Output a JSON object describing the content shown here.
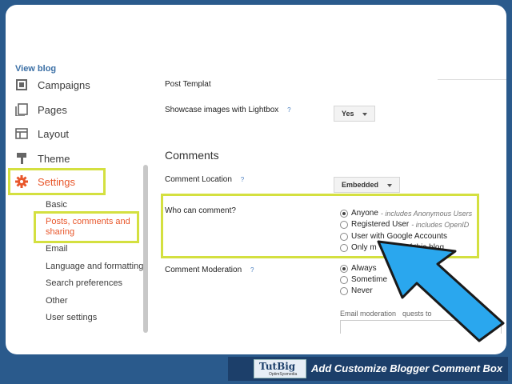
{
  "header": {
    "view_blog": "View blog"
  },
  "sidebar": {
    "items": [
      {
        "label": "Campaigns",
        "icon": "campaigns-icon"
      },
      {
        "label": "Pages",
        "icon": "pages-icon"
      },
      {
        "label": "Layout",
        "icon": "layout-icon"
      },
      {
        "label": "Theme",
        "icon": "theme-icon"
      },
      {
        "label": "Settings",
        "icon": "gear-icon"
      }
    ],
    "sub": [
      "Basic",
      "Posts, comments and sharing",
      "Email",
      "Language and formatting",
      "Search preferences",
      "Other",
      "User settings"
    ]
  },
  "main": {
    "post_template": "Post Templat",
    "showcase_label": "Showcase images with Lightbox",
    "showcase_value": "Yes",
    "section_title": "Comments",
    "comment_location_label": "Comment Location",
    "comment_location_value": "Embedded",
    "who_label": "Who can comment?",
    "who_options": [
      {
        "label": "Anyone",
        "note": "- includes Anonymous Users",
        "selected": true
      },
      {
        "label": "Registered User",
        "note": "- includes OpenID",
        "selected": false
      },
      {
        "label": "User with Google Accounts",
        "note": "",
        "selected": false
      },
      {
        "label": "Only m",
        "note": "",
        "selected": false
      },
      {
        "label": "of this blog",
        "note": "",
        "selected": false
      }
    ],
    "moderation_label": "Comment Moderation",
    "moderation_options": [
      {
        "label": "Always",
        "selected": true
      },
      {
        "label": "Sometime",
        "selected": false
      },
      {
        "label": "Never",
        "selected": false
      }
    ],
    "email_moderation": "Email moderation",
    "email_moderation_tail": "quests to",
    "help": "?"
  },
  "banner": {
    "logo_text": "TutBig",
    "logo_sub": "OptimSysmedia",
    "title": "Add Customize Blogger Comment Box"
  },
  "colors": {
    "highlight": "#d4e040",
    "arrow": "#2aa7ee",
    "settings": "#e8562a",
    "link": "#3b6fa5"
  }
}
